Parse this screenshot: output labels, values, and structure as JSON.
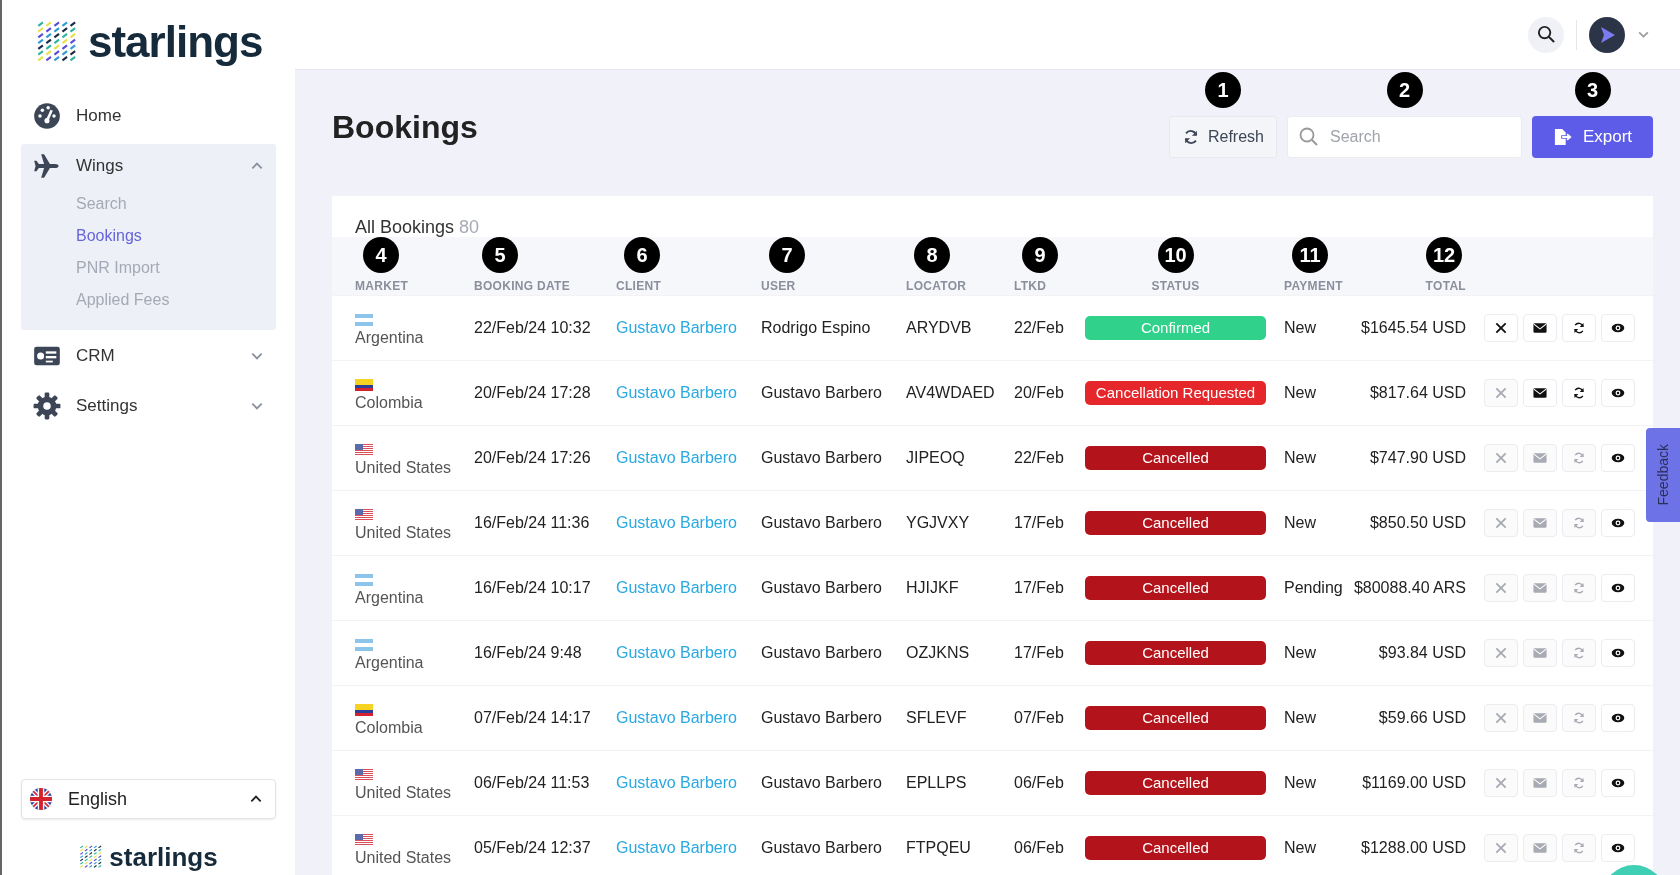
{
  "sidebar": {
    "logo": "starlings",
    "nav": [
      {
        "label": "Home"
      },
      {
        "label": "Wings",
        "expanded": true,
        "children": [
          {
            "label": "Search",
            "selected": false
          },
          {
            "label": "Bookings",
            "selected": true
          },
          {
            "label": "PNR Import",
            "selected": false
          },
          {
            "label": "Applied Fees",
            "selected": false
          }
        ]
      },
      {
        "label": "CRM",
        "expanded": false
      },
      {
        "label": "Settings",
        "expanded": false
      }
    ],
    "language": "English",
    "footer_logo": "starlings"
  },
  "page": {
    "title": "Bookings",
    "refresh": {
      "label": "Refresh",
      "callout": "1"
    },
    "search": {
      "placeholder": "Search",
      "callout": "2"
    },
    "export": {
      "label": "Export",
      "callout": "3"
    }
  },
  "table": {
    "title": "All Bookings",
    "count": "80",
    "columns": [
      {
        "label": "MARKET",
        "callout": "4"
      },
      {
        "label": "BOOKING DATE",
        "callout": "5"
      },
      {
        "label": "CLIENT",
        "callout": "6"
      },
      {
        "label": "USER",
        "callout": "7"
      },
      {
        "label": "LOCATOR",
        "callout": "8"
      },
      {
        "label": "LTKD",
        "callout": "9"
      },
      {
        "label": "STATUS",
        "callout": "10"
      },
      {
        "label": "PAYMENT",
        "callout": "11"
      },
      {
        "label": "TOTAL",
        "callout": "12"
      }
    ],
    "rows": [
      {
        "kind": "argentina",
        "market": "Argentina",
        "booking_date": "22/Feb/24 10:32",
        "client": "Gustavo Barbero",
        "user": "Rodrigo Espino",
        "locator": "ARYDVB",
        "ltkd": "22/Feb",
        "status": {
          "label": "Confirmed",
          "color": "#2fd18b"
        },
        "payment": "New",
        "total": "$1645.54 USD",
        "actions": [
          {
            "kind": "cancel",
            "disabled": false
          },
          {
            "kind": "email",
            "disabled": false
          },
          {
            "kind": "resend",
            "disabled": false
          },
          {
            "kind": "view",
            "disabled": false
          }
        ]
      },
      {
        "kind": "colombia",
        "market": "Colombia",
        "booking_date": "20/Feb/24 17:28",
        "client": "Gustavo Barbero",
        "user": "Gustavo Barbero",
        "locator": "AV4WDAED",
        "ltkd": "20/Feb",
        "status": {
          "label": "Cancellation Requested",
          "color": "#e5262b"
        },
        "payment": "New",
        "total": "$817.64 USD",
        "actions": [
          {
            "kind": "cancel",
            "disabled": true
          },
          {
            "kind": "email",
            "disabled": false
          },
          {
            "kind": "resend",
            "disabled": false
          },
          {
            "kind": "view",
            "disabled": false
          }
        ]
      },
      {
        "kind": "usa",
        "market": "United States",
        "booking_date": "20/Feb/24 17:26",
        "client": "Gustavo Barbero",
        "user": "Gustavo Barbero",
        "locator": "JIPEOQ",
        "ltkd": "22/Feb",
        "status": {
          "label": "Cancelled",
          "color": "#b3141b"
        },
        "payment": "New",
        "total": "$747.90 USD",
        "actions": [
          {
            "kind": "cancel",
            "disabled": true
          },
          {
            "kind": "email",
            "disabled": true
          },
          {
            "kind": "resend",
            "disabled": true
          },
          {
            "kind": "view",
            "disabled": false
          }
        ]
      },
      {
        "kind": "usa",
        "market": "United States",
        "booking_date": "16/Feb/24 11:36",
        "client": "Gustavo Barbero",
        "user": "Gustavo Barbero",
        "locator": "YGJVXY",
        "ltkd": "17/Feb",
        "status": {
          "label": "Cancelled",
          "color": "#b3141b"
        },
        "payment": "New",
        "total": "$850.50 USD",
        "actions": [
          {
            "kind": "cancel",
            "disabled": true
          },
          {
            "kind": "email",
            "disabled": true
          },
          {
            "kind": "resend",
            "disabled": true
          },
          {
            "kind": "view",
            "disabled": false
          }
        ]
      },
      {
        "kind": "argentina",
        "market": "Argentina",
        "booking_date": "16/Feb/24 10:17",
        "client": "Gustavo Barbero",
        "user": "Gustavo Barbero",
        "locator": "HJIJKF",
        "ltkd": "17/Feb",
        "status": {
          "label": "Cancelled",
          "color": "#b3141b"
        },
        "payment": "Pending",
        "total": "$80088.40 ARS",
        "actions": [
          {
            "kind": "cancel",
            "disabled": true
          },
          {
            "kind": "email",
            "disabled": true
          },
          {
            "kind": "resend",
            "disabled": true
          },
          {
            "kind": "view",
            "disabled": false
          }
        ]
      },
      {
        "kind": "argentina",
        "market": "Argentina",
        "booking_date": "16/Feb/24 9:48",
        "client": "Gustavo Barbero",
        "user": "Gustavo Barbero",
        "locator": "OZJKNS",
        "ltkd": "17/Feb",
        "status": {
          "label": "Cancelled",
          "color": "#b3141b"
        },
        "payment": "New",
        "total": "$93.84 USD",
        "actions": [
          {
            "kind": "cancel",
            "disabled": true
          },
          {
            "kind": "email",
            "disabled": true
          },
          {
            "kind": "resend",
            "disabled": true
          },
          {
            "kind": "view",
            "disabled": false
          }
        ]
      },
      {
        "kind": "colombia",
        "market": "Colombia",
        "booking_date": "07/Feb/24 14:17",
        "client": "Gustavo Barbero",
        "user": "Gustavo Barbero",
        "locator": "SFLEVF",
        "ltkd": "07/Feb",
        "status": {
          "label": "Cancelled",
          "color": "#b3141b"
        },
        "payment": "New",
        "total": "$59.66 USD",
        "actions": [
          {
            "kind": "cancel",
            "disabled": true
          },
          {
            "kind": "email",
            "disabled": true
          },
          {
            "kind": "resend",
            "disabled": true
          },
          {
            "kind": "view",
            "disabled": false
          }
        ]
      },
      {
        "kind": "usa",
        "market": "United States",
        "booking_date": "06/Feb/24 11:53",
        "client": "Gustavo Barbero",
        "user": "Gustavo Barbero",
        "locator": "EPLLPS",
        "ltkd": "06/Feb",
        "status": {
          "label": "Cancelled",
          "color": "#b3141b"
        },
        "payment": "New",
        "total": "$1169.00 USD",
        "actions": [
          {
            "kind": "cancel",
            "disabled": true
          },
          {
            "kind": "email",
            "disabled": true
          },
          {
            "kind": "resend",
            "disabled": true
          },
          {
            "kind": "view",
            "disabled": false
          }
        ]
      },
      {
        "kind": "usa",
        "market": "United States",
        "booking_date": "05/Feb/24 12:37",
        "client": "Gustavo Barbero",
        "user": "Gustavo Barbero",
        "locator": "FTPQEU",
        "ltkd": "06/Feb",
        "status": {
          "label": "Cancelled",
          "color": "#b3141b"
        },
        "payment": "New",
        "total": "$1288.00 USD",
        "actions": [
          {
            "kind": "cancel",
            "disabled": true
          },
          {
            "kind": "email",
            "disabled": true
          },
          {
            "kind": "resend",
            "disabled": true
          },
          {
            "kind": "view",
            "disabled": false
          }
        ]
      }
    ]
  },
  "feedback": "Feedback"
}
